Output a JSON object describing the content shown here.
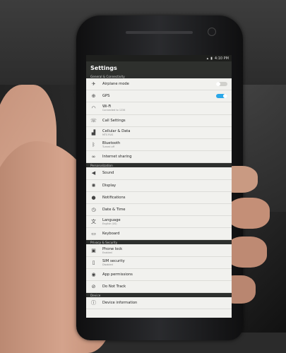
{
  "status": {
    "time": "4:10 PM",
    "signal_icon": "signal-icon",
    "battery_icon": "battery-icon"
  },
  "app": {
    "title": "Settings"
  },
  "sections": {
    "general": "General & Connectivity",
    "personalization": "Personalization",
    "privacy": "Privacy & Security",
    "device": "Device"
  },
  "items": {
    "airplane": {
      "label": "Airplane mode",
      "icon": "airplane-icon"
    },
    "gps": {
      "label": "GPS",
      "icon": "gps-icon"
    },
    "wifi": {
      "label": "Wi-Fi",
      "sub": "Connected to 1234",
      "icon": "wifi-icon"
    },
    "call": {
      "label": "Call Settings",
      "icon": "phone-icon"
    },
    "cellular": {
      "label": "Cellular & Data",
      "sub": "MTS RUS",
      "icon": "cellular-icon"
    },
    "bluetooth": {
      "label": "Bluetooth",
      "sub": "Turned off",
      "icon": "bluetooth-icon"
    },
    "sharing": {
      "label": "Internet sharing",
      "icon": "link-icon"
    },
    "sound": {
      "label": "Sound",
      "icon": "speaker-icon"
    },
    "display": {
      "label": "Display",
      "icon": "sun-icon"
    },
    "notifications": {
      "label": "Notifications",
      "icon": "bell-icon"
    },
    "datetime": {
      "label": "Date & Time",
      "icon": "clock-icon"
    },
    "language": {
      "label": "Language",
      "sub": "English (US)",
      "icon": "language-icon"
    },
    "keyboard": {
      "label": "Keyboard",
      "icon": "keyboard-icon"
    },
    "phonelock": {
      "label": "Phone lock",
      "sub": "Enabled",
      "icon": "lock-icon"
    },
    "sim": {
      "label": "SIM security",
      "sub": "Disabled",
      "icon": "sim-icon"
    },
    "permissions": {
      "label": "App permissions",
      "icon": "shield-icon"
    },
    "dnt": {
      "label": "Do Not Track",
      "icon": "block-icon"
    },
    "deviceinfo": {
      "label": "Device information",
      "icon": "info-icon"
    }
  },
  "colors": {
    "accent": "#2aa7e8",
    "screen_bg": "#f1f1ee",
    "header_bg": "#2e302d"
  }
}
